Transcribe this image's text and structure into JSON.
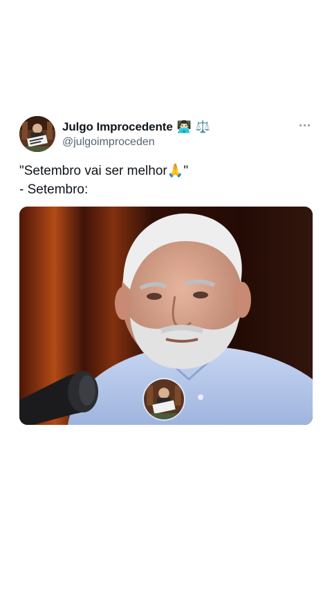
{
  "tweet": {
    "author": {
      "display_name": "Julgo Improcedente",
      "badges": [
        "man-technologist-emoji",
        "balance-scale-emoji"
      ],
      "handle": "@julgoimproceden"
    },
    "text": "\"Setembro vai ser melhor🙏\"\n- Setembro:",
    "media": {
      "type": "video-frame",
      "description_icon": "man-with-microphone-image",
      "watermark_icon": "channel-avatar-watermark"
    },
    "more_icon": "more-options-icon"
  },
  "colors": {
    "text": "#0f1419",
    "secondary": "#536471",
    "background": "#ffffff"
  }
}
